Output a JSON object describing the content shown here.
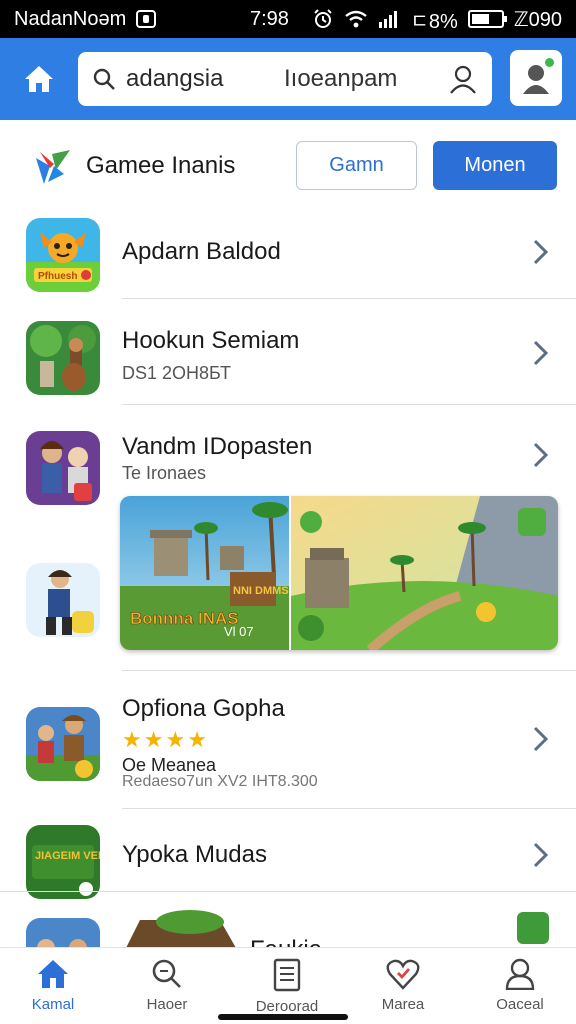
{
  "status_bar": {
    "carrier": "NadanNoəm",
    "time": "7:98",
    "battery_text": "ㄷ8%",
    "extra": "ℤ090",
    "battery_level": 0.6
  },
  "header": {
    "search_query": "adangsia",
    "search_hint": "Iıoeanpam",
    "icons": [
      "home-icon",
      "search-icon",
      "person-icon",
      "avatar-icon"
    ]
  },
  "category": {
    "title": "Gamee Inanis",
    "outline_button": "Gamn",
    "solid_button": "Monen"
  },
  "list": [
    {
      "title": "Apdarn Baldod",
      "subtitle": ""
    },
    {
      "title": "Hookun Semiam",
      "subtitle": "DS1 2ОН8БТ"
    },
    {
      "title": "Vandm IDopasten",
      "subtitle": "Te Ironaes"
    },
    {
      "title": "Opfiona Gopha",
      "subtitle": "Oe Meanea",
      "detail": "Redaeso7un XV2 IHT8.300",
      "rating": 4
    },
    {
      "title": "Ypoka Mudas",
      "subtitle": ""
    },
    {
      "title": "Faukia",
      "subtitle": ""
    }
  ],
  "banner": {
    "left_text": "Bonnna INAS",
    "left_tag": "Vl 07",
    "sign_text": "NNI DMMS"
  },
  "icon_texts": {
    "first": "Pfhuesh",
    "fifth": "JIAGEIM VENRS"
  },
  "bottom_nav": [
    {
      "label": "Kamal",
      "icon": "home-icon",
      "active": true
    },
    {
      "label": "Haoer",
      "icon": "search-icon",
      "active": false
    },
    {
      "label": "Deroorad",
      "icon": "document-icon",
      "active": false
    },
    {
      "label": "Marea",
      "icon": "heart-icon",
      "active": false
    },
    {
      "label": "Oaceal",
      "icon": "person-icon",
      "active": false
    }
  ],
  "colors": {
    "header_blue": "#2f7ee3",
    "primary_button": "#2c6fd6",
    "star": "#f4b400"
  }
}
